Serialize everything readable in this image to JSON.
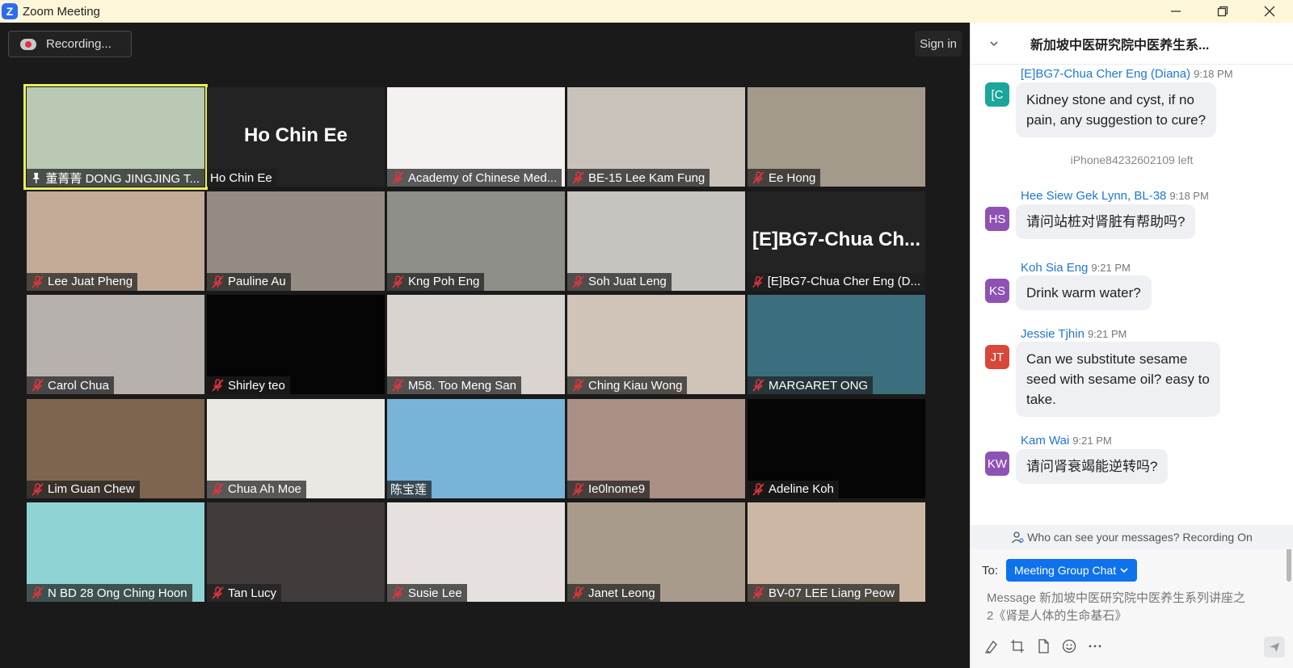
{
  "window": {
    "title": "Zoom Meeting",
    "logo_letter": "Z"
  },
  "toolbar": {
    "recording_label": "Recording...",
    "sign_in_label": "Sign in"
  },
  "participants": [
    {
      "name": "董菁菁 DONG JINGJING T...",
      "muted": false,
      "pinned": true,
      "active": true,
      "video": "#b9c9b4"
    },
    {
      "name": "Ho Chin Ee",
      "muted": false,
      "display_name": "Ho Chin Ee",
      "video": "#232323"
    },
    {
      "name": "Academy of Chinese Med...",
      "muted": true,
      "video": "#f4f1f0"
    },
    {
      "name": "BE-15 Lee Kam Fung",
      "muted": true,
      "video": "#c9c2ba"
    },
    {
      "name": "Ee Hong",
      "muted": true,
      "video": "#a49a8c"
    },
    {
      "name": "Lee Juat Pheng",
      "muted": true,
      "video": "#c3ab98"
    },
    {
      "name": "Pauline Au",
      "muted": true,
      "video": "#948b83"
    },
    {
      "name": "Kng Poh Eng",
      "muted": true,
      "video": "#8e8f88"
    },
    {
      "name": "Soh Juat Leng",
      "muted": true,
      "video": "#c7c4c0"
    },
    {
      "name": "[E]BG7-Chua Cher Eng (D...",
      "muted": true,
      "display_name": "[E]BG7-Chua  Ch...",
      "video": "#232323"
    },
    {
      "name": "Carol Chua",
      "muted": true,
      "video": "#b7b1ad"
    },
    {
      "name": "Shirley teo",
      "muted": true,
      "video": "#050505"
    },
    {
      "name": "M58. Too Meng San",
      "muted": true,
      "video": "#d9d4cf"
    },
    {
      "name": "Ching Kiau Wong",
      "muted": true,
      "video": "#cfc4b7"
    },
    {
      "name": "MARGARET ONG",
      "muted": true,
      "video": "#3b6f7d"
    },
    {
      "name": "Lim Guan Chew",
      "muted": true,
      "video": "#7d6550"
    },
    {
      "name": "Chua Ah Moe",
      "muted": true,
      "video": "#ebe8e4"
    },
    {
      "name": "陈宝莲",
      "muted": false,
      "video": "#77b4d8"
    },
    {
      "name": "Ie0lnome9",
      "muted": true,
      "video": "#a98f86"
    },
    {
      "name": "Adeline Koh",
      "muted": true,
      "video": "#050505"
    },
    {
      "name": "N BD 28 Ong Ching Hoon",
      "muted": true,
      "video": "#8fd3d4"
    },
    {
      "name": "Tan Lucy",
      "muted": true,
      "video": "#413b3b"
    },
    {
      "name": "Susie Lee",
      "muted": true,
      "video": "#e6e1df"
    },
    {
      "name": "Janet Leong",
      "muted": true,
      "video": "#a99b8c"
    },
    {
      "name": "BV-07 LEE Liang Peow",
      "muted": true,
      "video": "#cbb7a3"
    }
  ],
  "chat": {
    "title": "新加坡中医研究院中医养生系...",
    "messages": [
      {
        "initials": "[C",
        "avatar_color": "#1aa69a",
        "sender": "[E]BG7-Chua Cher Eng (Diana)",
        "time": "9:18 PM",
        "text_lines": [
          "Kidney stone and cyst, if no",
          "pain, any suggestion to cure?"
        ]
      },
      {
        "initials": "HS",
        "avatar_color": "#8e52b5",
        "sender": "Hee Siew Gek Lynn, BL-38",
        "time": "9:18 PM",
        "text_lines": [
          "请问站桩对肾脏有帮助吗?"
        ]
      },
      {
        "initials": "KS",
        "avatar_color": "#8e52b5",
        "sender": "Koh Sia Eng",
        "time": "9:21 PM",
        "text_lines": [
          "Drink warm water?"
        ]
      },
      {
        "initials": "JT",
        "avatar_color": "#d9463a",
        "sender": "Jessie Tjhin",
        "time": "9:21 PM",
        "text_lines": [
          "Can we substitute sesame",
          "seed with sesame oil? easy to",
          "take."
        ]
      },
      {
        "initials": "KW",
        "avatar_color": "#8e52b5",
        "sender": "Kam Wai",
        "time": "9:21 PM",
        "text_lines": [
          "请问肾衰竭能逆转吗?"
        ]
      }
    ],
    "system_note": "iPhone84232602109 left",
    "visibility_notice": "Who can see your messages? Recording On",
    "to_label": "To:",
    "recipient": "Meeting Group Chat",
    "compose_placeholder_line1": "Message 新加坡中医研究院中医养生系列讲座之",
    "compose_placeholder_line2": "2《肾是人体的生命基石》"
  }
}
